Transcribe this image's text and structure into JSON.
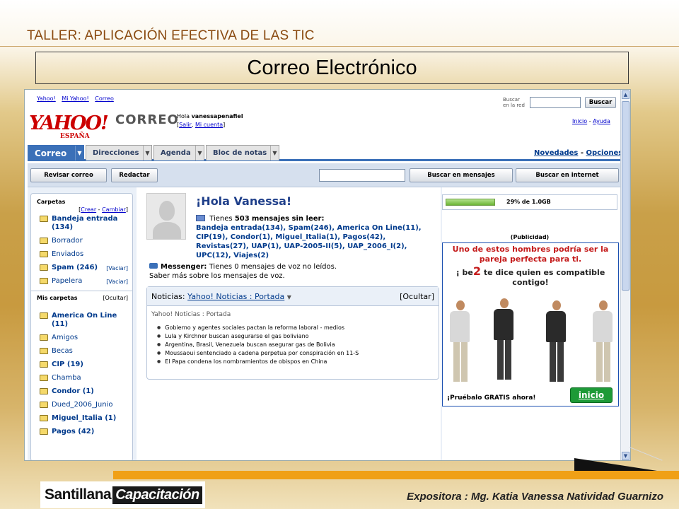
{
  "slide": {
    "title": "TALLER: APLICACIÓN EFECTIVA DE LAS TIC",
    "box_title": "Correo Electrónico",
    "presenter": "Expositora : Mg. Katia Vanessa Natividad Guarnizo",
    "logo": {
      "part1": "Santillana",
      "part2": "Capacitación"
    }
  },
  "yahoo": {
    "top_links": [
      "Yahoo!",
      "Mi Yahoo!",
      "Correo"
    ],
    "search": {
      "label": "Buscar en la red",
      "value": "",
      "button": "Buscar"
    },
    "logo": {
      "main": "YAHOO!",
      "sub": "ESPAÑA"
    },
    "product": "CORREO",
    "greeting": {
      "hello": "Hola",
      "user": "vanessapenafiel",
      "link1": "Salir",
      "link2": "Mi cuenta"
    },
    "help": {
      "home": "Inicio",
      "help": "Ayuda"
    },
    "tabs": [
      "Correo",
      "Direcciones",
      "Agenda",
      "Bloc de notas"
    ],
    "news_link": "Novedades",
    "options_link": "Opciones",
    "toolbar": {
      "check": "Revisar correo",
      "compose": "Redactar",
      "search_value": "",
      "search_messages": "Buscar en mensajes",
      "search_web": "Buscar en internet"
    },
    "folders_heading": "Carpetas",
    "folders_actions": {
      "create": "Crear",
      "change": "Cambiar"
    },
    "folders": [
      {
        "name": "Bandeja entrada (134)",
        "bold": true
      },
      {
        "name": "Borrador",
        "bold": false
      },
      {
        "name": "Enviados",
        "bold": false
      },
      {
        "name": "Spam (246)",
        "bold": true,
        "action": "[Vaciar]"
      },
      {
        "name": "Papelera",
        "bold": false,
        "action": "[Vaciar]"
      }
    ],
    "my_folders_heading": "Mis carpetas",
    "my_folders_action": "[Ocultar]",
    "my_folders": [
      {
        "name": "America On Line (11)",
        "bold": true
      },
      {
        "name": "Amigos",
        "bold": false
      },
      {
        "name": "Becas",
        "bold": false
      },
      {
        "name": "CIP (19)",
        "bold": true
      },
      {
        "name": "Chamba",
        "bold": false
      },
      {
        "name": "Condor (1)",
        "bold": true
      },
      {
        "name": "Dued_2006_Junio",
        "bold": false
      },
      {
        "name": "Miguel_Italia (1)",
        "bold": true
      },
      {
        "name": "Pagos (42)",
        "bold": true
      }
    ],
    "welcome": "¡Hola Vanessa!",
    "unread": {
      "prefix": "Tienes",
      "count": "503",
      "suffix": "mensajes sin leer:",
      "list": "Bandeja entrada(134), Spam(246), America On Line(11), CIP(19), Condor(1), Miguel_Italia(1), Pagos(42), Revistas(27), UAP(1), UAP-2005-II(5), UAP_2006_I(2), UPC(12), Viajes(2)"
    },
    "messenger": {
      "label": "Messenger:",
      "text": "Tienes 0 mensajes de voz no leídos.",
      "more": "Saber más sobre los mensajes de voz."
    },
    "news": {
      "label": "Noticias:",
      "source": "Yahoo! Noticias : Portada",
      "hide": "[Ocultar]",
      "subtitle": "Yahoo! Noticias : Portada",
      "items": [
        "Gobierno y agentes sociales pactan la reforma laboral - medios",
        "Lula y Kirchner buscan asegurarse el gas boliviano",
        "Argentina, Brasil, Venezuela buscan asegurar gas de Bolivia",
        "Moussaoui sentenciado a cadena perpetua por conspiración en 11-S",
        "El Papa condena los nombramientos de obispos en China"
      ]
    },
    "storage": {
      "percent": 29,
      "text": "29% de 1.0GB"
    },
    "ad": {
      "label": "(Publicidad)",
      "headline": "Uno de estos hombres podría ser la pareja perfecta para ti.",
      "brand_pre": "¡ be",
      "brand_num": "2",
      "tagline": "te dice quien es compatible contigo!",
      "cta": "¡Pruébalo GRATIS ahora!",
      "button": "inicio"
    }
  }
}
